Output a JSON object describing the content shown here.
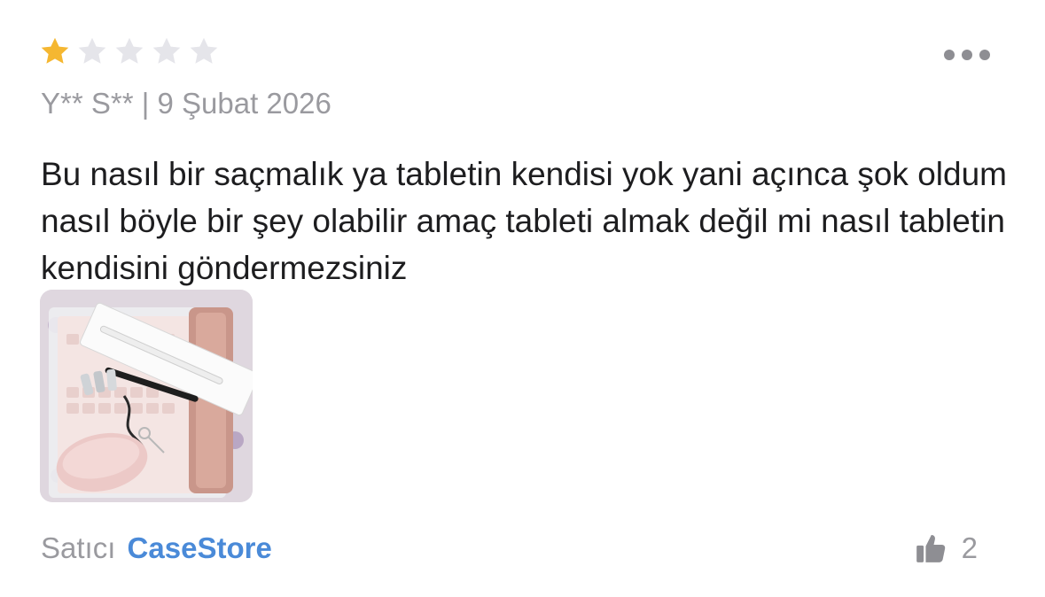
{
  "review": {
    "rating": 1,
    "max_rating": 5,
    "star_filled_color": "#f5b731",
    "star_empty_color": "#e5e5ea",
    "author": "Y** S**",
    "separator": "|",
    "date": "9 Şubat 2026",
    "text": "Bu nasıl bir saçmalık ya tabletin kendisi yok yani açınca şok oldum nasıl böyle bir şey olabilir amaç tableti almak değil mi nasıl tabletin kendisini göndermezsiniz",
    "more_icon": "more-horizontal-icon",
    "photo_count": 1
  },
  "seller": {
    "prefix": "Satıcı",
    "name": "CaseStore",
    "name_color": "#4a8ad8"
  },
  "like": {
    "icon": "thumbs-up-icon",
    "count": "2"
  }
}
